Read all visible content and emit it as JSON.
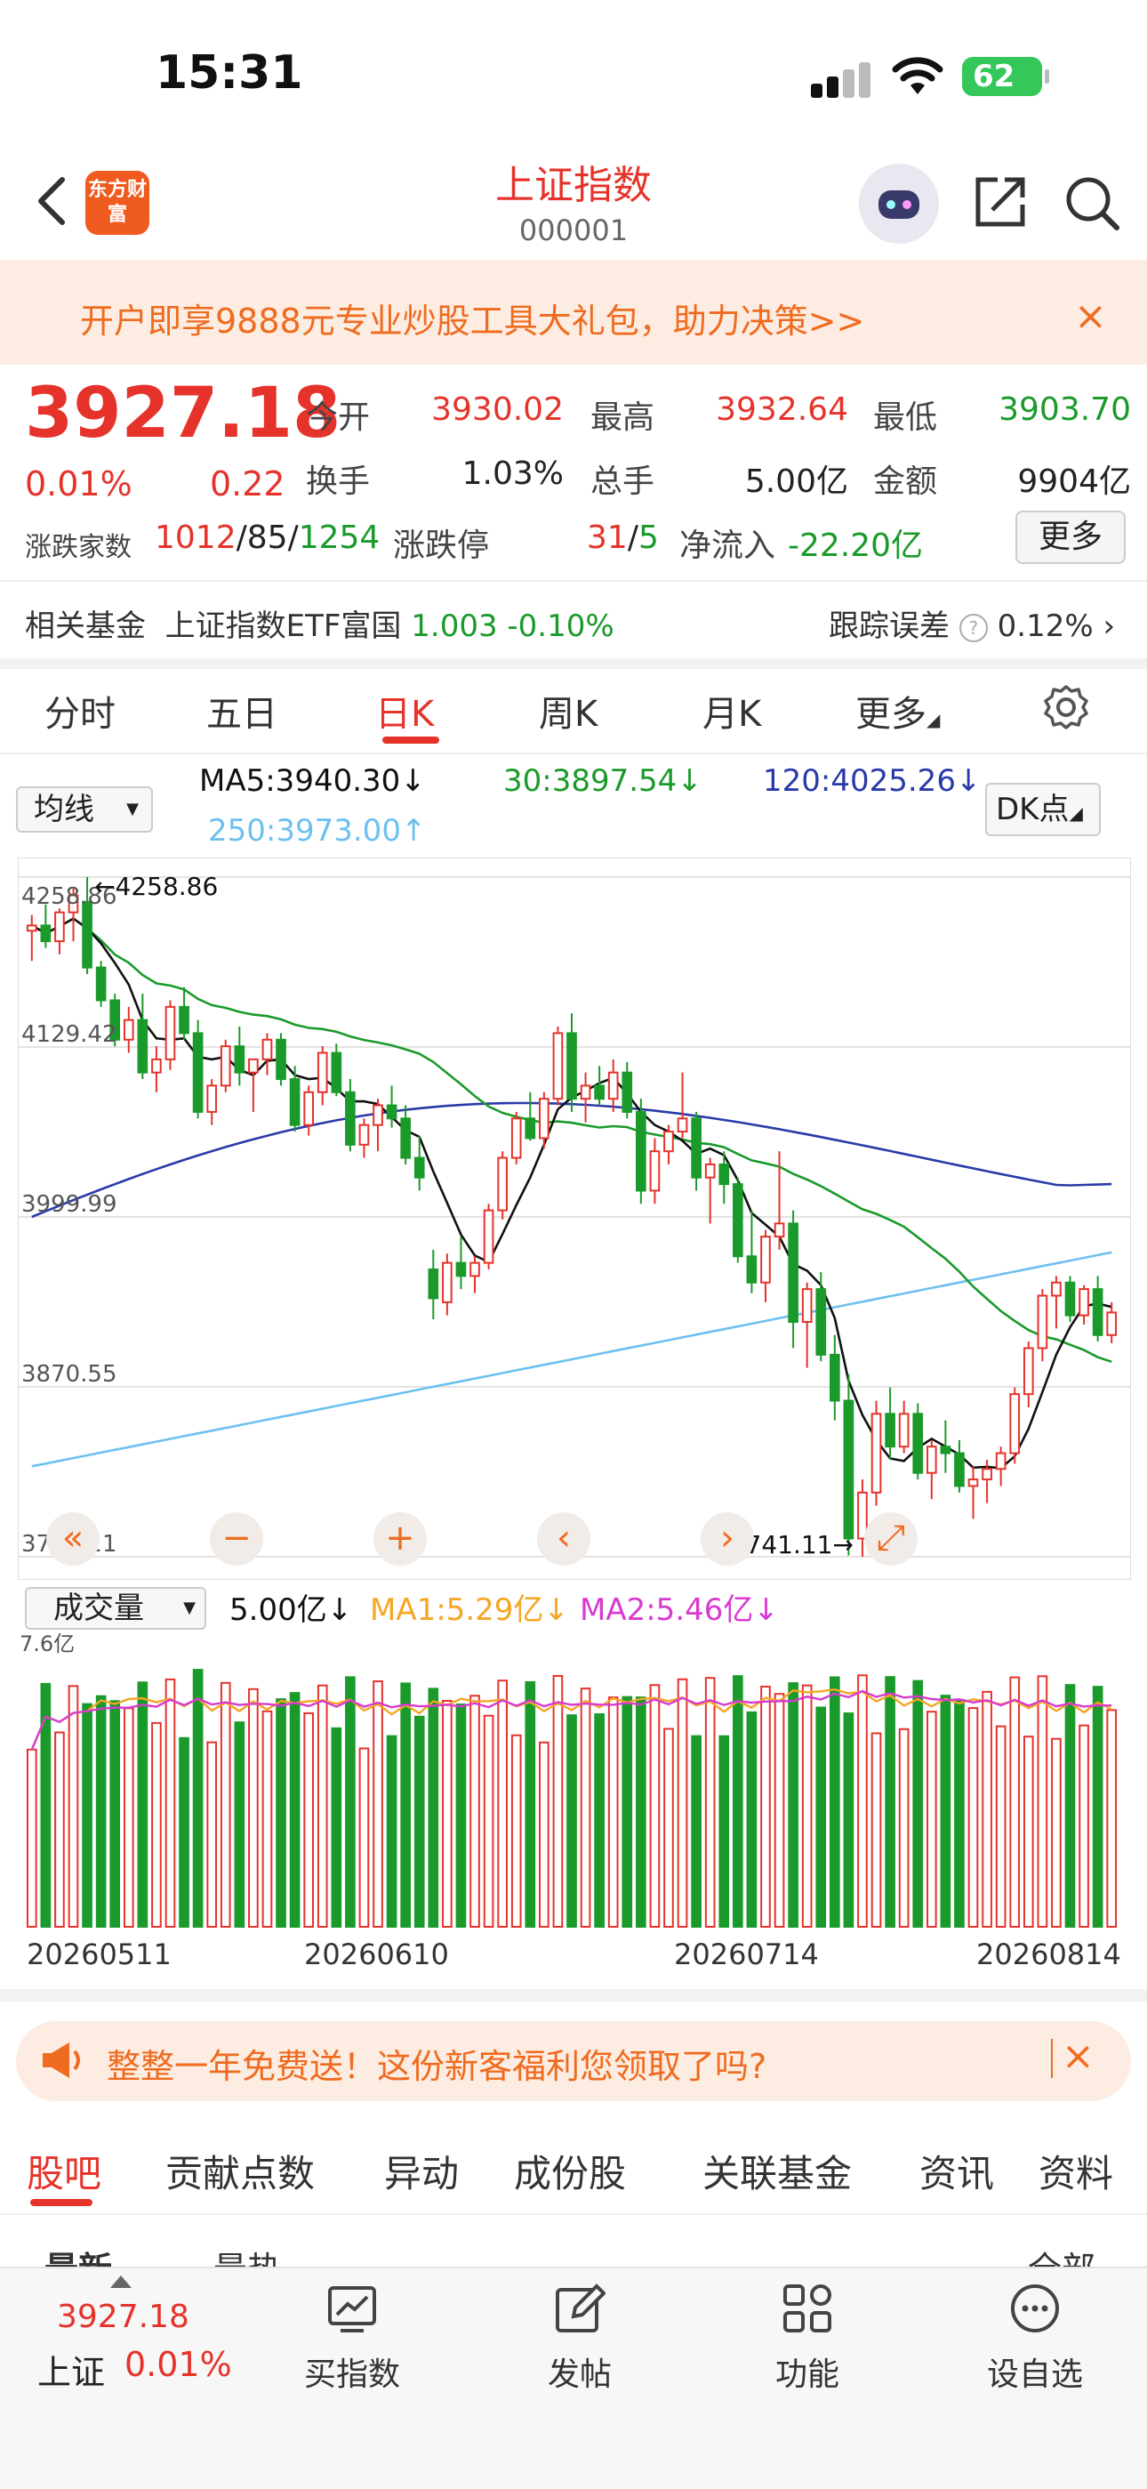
{
  "status": {
    "time": "15:31",
    "battery": "62"
  },
  "header": {
    "title": "上证指数",
    "code": "000001",
    "logo_text": "东方财富"
  },
  "banner": {
    "text": "开户即享9888元专业炒股工具大礼包，助力决策>>",
    "close": "×"
  },
  "quote": {
    "price": "3927.18",
    "pct": "0.01%",
    "change": "0.22",
    "open_label": "今开",
    "open": "3930.02",
    "high_label": "最高",
    "high": "3932.64",
    "low_label": "最低",
    "low": "3903.70",
    "turnover_label": "换手",
    "turnover": "1.03%",
    "volume_label": "总手",
    "volume": "5.00亿",
    "amount_label": "金额",
    "amount": "9904亿",
    "breadth_label": "涨跌家数",
    "breadth_up": "1012",
    "breadth_flat": "85",
    "breadth_down": "1254",
    "limit_label": "涨跌停",
    "limit_up": "31",
    "limit_down": "5",
    "netflow_label": "净流入",
    "netflow": "-22.20亿",
    "more": "更多"
  },
  "fund": {
    "label": "相关基金",
    "name": "上证指数ETF富国",
    "price": "1.003",
    "pct": "-0.10%",
    "err_label": "跟踪误差",
    "err": "0.12%"
  },
  "tabs": [
    "分时",
    "五日",
    "日K",
    "周K",
    "月K",
    "更多"
  ],
  "ma": {
    "select": "均线",
    "ma5": "MA5:3940.30↓",
    "ma30": "30:3897.54↓",
    "ma120": "120:4025.26↓",
    "ma250": "250:3973.00↑",
    "dk": "DK点"
  },
  "chart_data": {
    "type": "candlestick",
    "yticks": [
      "4258.86",
      "4129.42",
      "3999.99",
      "3870.55",
      "3741.11"
    ],
    "ylim": [
      3741.11,
      4258.86
    ],
    "high_marker": "4258.86",
    "low_marker": "3741.11",
    "x_dates": [
      "20260511",
      "20260610",
      "20260714",
      "20260814"
    ],
    "candles_ohlc": [
      [
        4218,
        4230,
        4195,
        4222
      ],
      [
        4222,
        4238,
        4205,
        4210
      ],
      [
        4210,
        4235,
        4200,
        4232
      ],
      [
        4232,
        4250,
        4210,
        4245
      ],
      [
        4240,
        4258.86,
        4185,
        4190
      ],
      [
        4190,
        4195,
        4160,
        4165
      ],
      [
        4165,
        4170,
        4130,
        4135
      ],
      [
        4135,
        4160,
        4125,
        4150
      ],
      [
        4150,
        4170,
        4105,
        4110
      ],
      [
        4110,
        4130,
        4095,
        4120
      ],
      [
        4120,
        4165,
        4112,
        4160
      ],
      [
        4160,
        4175,
        4135,
        4140
      ],
      [
        4140,
        4150,
        4075,
        4080
      ],
      [
        4080,
        4105,
        4070,
        4100
      ],
      [
        4100,
        4135,
        4095,
        4130
      ],
      [
        4130,
        4145,
        4100,
        4110
      ],
      [
        4110,
        4120,
        4080,
        4120
      ],
      [
        4120,
        4140,
        4108,
        4135
      ],
      [
        4135,
        4140,
        4100,
        4105
      ],
      [
        4105,
        4115,
        4065,
        4070
      ],
      [
        4070,
        4100,
        4062,
        4095
      ],
      [
        4095,
        4130,
        4085,
        4125
      ],
      [
        4125,
        4132,
        4092,
        4095
      ],
      [
        4095,
        4105,
        4050,
        4055
      ],
      [
        4055,
        4075,
        4045,
        4070
      ],
      [
        4070,
        4090,
        4050,
        4085
      ],
      [
        4085,
        4100,
        4068,
        4075
      ],
      [
        4075,
        4085,
        4040,
        4045
      ],
      [
        4045,
        4062,
        4020,
        4030
      ],
      [
        3960,
        3975,
        3922,
        3938
      ],
      [
        3935,
        3972,
        3925,
        3965
      ],
      [
        3965,
        3985,
        3945,
        3955
      ],
      [
        3955,
        3970,
        3942,
        3965
      ],
      [
        3965,
        4010,
        3960,
        4005
      ],
      [
        4005,
        4050,
        3998,
        4045
      ],
      [
        4045,
        4080,
        4040,
        4075
      ],
      [
        4075,
        4095,
        4058,
        4060
      ],
      [
        4060,
        4095,
        4052,
        4090
      ],
      [
        4090,
        4145,
        4085,
        4140
      ],
      [
        4140,
        4155,
        4080,
        4090
      ],
      [
        4090,
        4110,
        4072,
        4100
      ],
      [
        4100,
        4115,
        4085,
        4090
      ],
      [
        4090,
        4120,
        4080,
        4110
      ],
      [
        4110,
        4118,
        4075,
        4080
      ],
      [
        4080,
        4090,
        4010,
        4020
      ],
      [
        4020,
        4060,
        4010,
        4050
      ],
      [
        4050,
        4070,
        4040,
        4065
      ],
      [
        4065,
        4110,
        4060,
        4075
      ],
      [
        4075,
        4080,
        4020,
        4030
      ],
      [
        4030,
        4045,
        3995,
        4040
      ],
      [
        4040,
        4050,
        4010,
        4025
      ],
      [
        4025,
        4030,
        3965,
        3970
      ],
      [
        3970,
        4005,
        3942,
        3950
      ],
      [
        3950,
        3990,
        3935,
        3985
      ],
      [
        3985,
        4050,
        3975,
        3995
      ],
      [
        3995,
        4005,
        3900,
        3920
      ],
      [
        3920,
        3950,
        3885,
        3945
      ],
      [
        3945,
        3958,
        3890,
        3895
      ],
      [
        3895,
        3910,
        3845,
        3860
      ],
      [
        3860,
        3880,
        3742,
        3755
      ],
      [
        3755,
        3800,
        3741.11,
        3790
      ],
      [
        3790,
        3860,
        3780,
        3850
      ],
      [
        3850,
        3870,
        3815,
        3825
      ],
      [
        3825,
        3860,
        3820,
        3850
      ],
      [
        3850,
        3858,
        3800,
        3805
      ],
      [
        3805,
        3830,
        3785,
        3825
      ],
      [
        3825,
        3845,
        3805,
        3820
      ],
      [
        3820,
        3830,
        3790,
        3795
      ],
      [
        3795,
        3810,
        3770,
        3800
      ],
      [
        3800,
        3815,
        3782,
        3808
      ],
      [
        3808,
        3825,
        3795,
        3820
      ],
      [
        3820,
        3870,
        3812,
        3865
      ],
      [
        3865,
        3905,
        3855,
        3900
      ],
      [
        3900,
        3945,
        3890,
        3940
      ],
      [
        3940,
        3955,
        3915,
        3950
      ],
      [
        3950,
        3955,
        3920,
        3925
      ],
      [
        3925,
        3948,
        3918,
        3945
      ],
      [
        3945,
        3955,
        3905,
        3910
      ],
      [
        3910,
        3935,
        3903.7,
        3927.18
      ]
    ]
  },
  "controls": {
    "fast_back": "«",
    "zoom_out": "−",
    "zoom_in": "+",
    "prev": "‹",
    "next": "›",
    "fullscreen": "⤢"
  },
  "volume": {
    "select": "成交量",
    "value": "5.00亿↓",
    "ma1": "MA1:5.29亿↓",
    "ma2": "MA2:5.46亿↓",
    "ymax": "7.6亿"
  },
  "promo": {
    "text": "整整一年免费送！这份新客福利您领取了吗?",
    "close": "×"
  },
  "bottom_tabs": [
    "股吧",
    "贡献点数",
    "异动",
    "成份股",
    "关联基金",
    "资讯",
    "资料"
  ],
  "sub_tabs": {
    "latest": "最新",
    "hot": "最热",
    "filter": "全部"
  },
  "nav": {
    "price": "3927.18",
    "name": "上证",
    "pct": "0.01%",
    "items": [
      "买指数",
      "发帖",
      "功能",
      "设自选"
    ]
  },
  "colors": {
    "up": "#e5332b",
    "down": "#1a9a2a",
    "ma5": "#111111",
    "ma30": "#1a9a2a",
    "ma120": "#2a3aa8",
    "ma250": "#6ec0f0",
    "accent": "#ef6b1f"
  }
}
